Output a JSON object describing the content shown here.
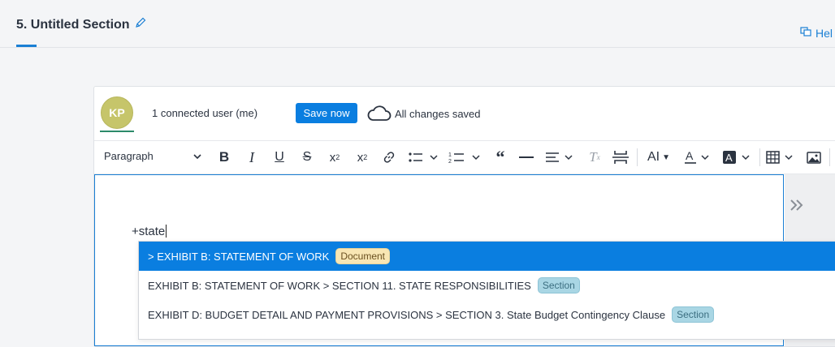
{
  "header": {
    "section_title": "5. Untitled Section",
    "help_label": "Hel"
  },
  "collab": {
    "avatar_initials": "KP",
    "connected_text": "1 connected user (me)",
    "save_label": "Save now",
    "saved_status": "All changes saved"
  },
  "toolbar": {
    "paragraph_label": "Paragraph",
    "items": [
      "bold-icon",
      "italic-icon",
      "underline-icon",
      "strikethrough-icon",
      "subscript-icon",
      "superscript-icon",
      "link-icon",
      "bulleted-list-icon",
      "numbered-list-icon",
      "blockquote-icon",
      "horizontal-line-icon",
      "align-icon",
      "remove-format-icon",
      "page-break-icon",
      "text-size-icon",
      "font-color-icon",
      "highlight-icon",
      "table-icon",
      "image-icon"
    ]
  },
  "editor": {
    "typed_text": "+state"
  },
  "suggestions": [
    {
      "text": "> EXHIBIT B: STATEMENT OF WORK",
      "badge": "Document",
      "active": true
    },
    {
      "text": "EXHIBIT B: STATEMENT OF WORK > SECTION 11. STATE RESPONSIBILITIES",
      "badge": "Section",
      "active": false
    },
    {
      "text": "EXHIBIT D: BUDGET DETAIL AND PAYMENT PROVISIONS > SECTION 3. State Budget Contingency Clause",
      "badge": "Section",
      "active": false
    }
  ],
  "colors": {
    "accent": "#0a7ee0",
    "document_badge": "#f8e6b4",
    "section_badge": "#a9d6e4",
    "avatar": "#c6c56a"
  }
}
